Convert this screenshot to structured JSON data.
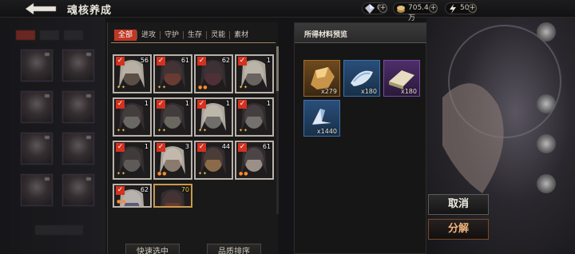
{
  "header": {
    "title": "魂核养成",
    "resources": [
      {
        "icon": "gem-icon",
        "value": "0"
      },
      {
        "icon": "gold-icon",
        "value": "705.4万"
      },
      {
        "icon": "stamina-bolt-icon",
        "value": "50"
      }
    ],
    "plus": "+"
  },
  "inventory": {
    "tabs": [
      "全部",
      "进攻",
      "守护",
      "生存",
      "灵能",
      "素材"
    ],
    "active_tab": 0,
    "check": "✓",
    "cards": [
      {
        "level": "56",
        "rarity": "white",
        "selected": true,
        "stars": "✦✦",
        "star_color": "gold"
      },
      {
        "level": "61",
        "rarity": "white",
        "selected": true,
        "stars": "✦✦",
        "star_color": "gold"
      },
      {
        "level": "62",
        "rarity": "white",
        "selected": true,
        "stars": "●●",
        "star_color": "orange"
      },
      {
        "level": "1",
        "rarity": "white",
        "selected": true,
        "stars": "✦✦",
        "star_color": "gold"
      },
      {
        "level": "1",
        "rarity": "white",
        "selected": true,
        "stars": "✦✦",
        "star_color": "gold"
      },
      {
        "level": "1",
        "rarity": "white",
        "selected": true,
        "stars": "✦✦",
        "star_color": "gold"
      },
      {
        "level": "1",
        "rarity": "white",
        "selected": true,
        "stars": "✦✦",
        "star_color": "gold"
      },
      {
        "level": "1",
        "rarity": "white",
        "selected": true,
        "stars": "✦✦",
        "star_color": "gold"
      },
      {
        "level": "1",
        "rarity": "white",
        "selected": true,
        "stars": "✦✦",
        "star_color": "gold"
      },
      {
        "level": "3",
        "rarity": "white",
        "selected": true,
        "stars": "●●",
        "star_color": "orange"
      },
      {
        "level": "44",
        "rarity": "white",
        "selected": true,
        "stars": "✦✦",
        "star_color": "gold"
      },
      {
        "level": "61",
        "rarity": "white",
        "selected": true,
        "stars": "●●",
        "star_color": "orange"
      },
      {
        "level": "62",
        "rarity": "white",
        "selected": true,
        "stars": "●●",
        "star_color": "orange"
      },
      {
        "level": "70",
        "rarity": "gold",
        "selected": false,
        "stars": "",
        "star_color": "gold"
      }
    ],
    "quick_select": "快速选中",
    "quality_sort": "品质排序"
  },
  "materials": {
    "title": "所得材料预览",
    "items": [
      {
        "icon": "gold-ore-icon",
        "color": "orange",
        "qty": "x279"
      },
      {
        "icon": "blue-crystal-icon",
        "color": "blue",
        "qty": "x180"
      },
      {
        "icon": "purple-scroll-icon",
        "color": "purple",
        "qty": "x180"
      },
      {
        "icon": "blue-shard-icon",
        "color": "blue",
        "qty": "x1440"
      }
    ]
  },
  "actions": {
    "cancel": "取消",
    "decompose": "分解"
  }
}
